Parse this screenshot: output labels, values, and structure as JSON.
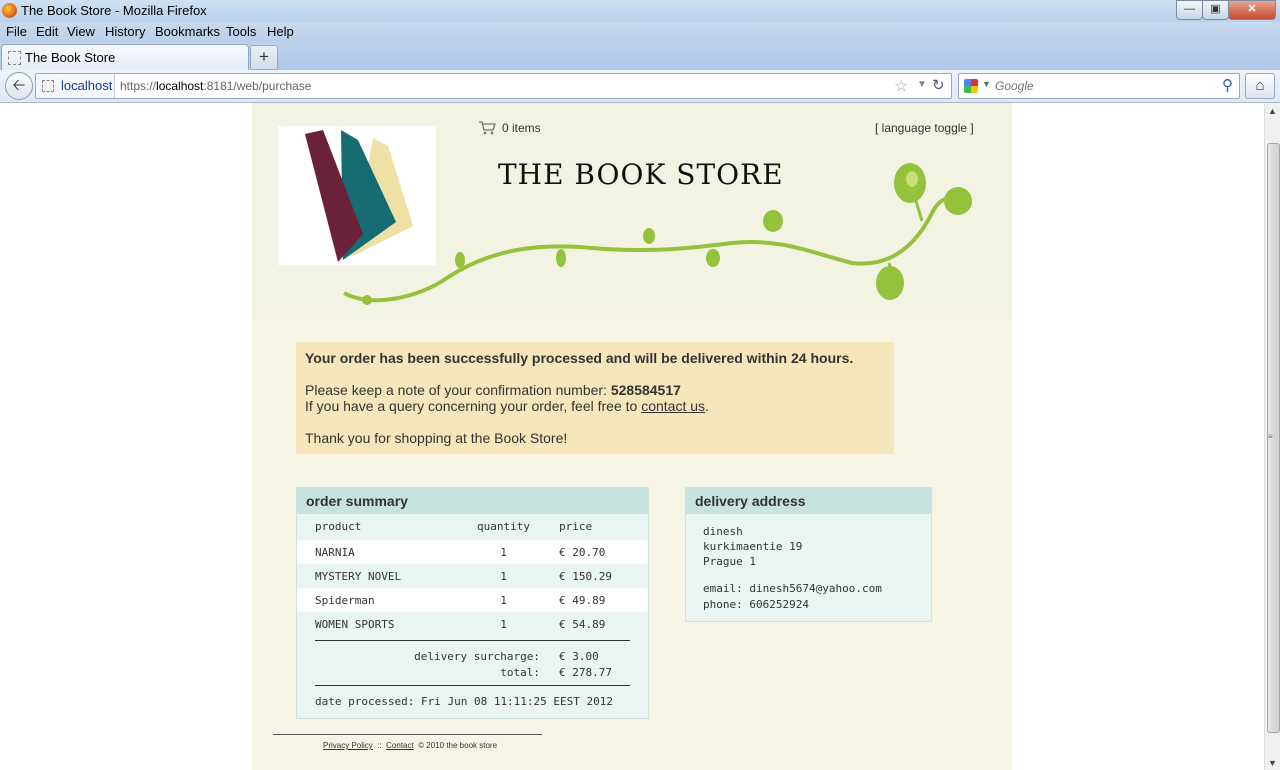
{
  "window": {
    "title": "The Book Store - Mozilla Firefox"
  },
  "menu": {
    "items": [
      "File",
      "Edit",
      "View",
      "History",
      "Bookmarks",
      "Tools",
      "Help"
    ]
  },
  "tabs": [
    {
      "label": "The Book Store"
    }
  ],
  "nav": {
    "identity_host": "localhost",
    "url_prefix": "https://",
    "url_host": "localhost",
    "url_rest": ":8181/web/purchase",
    "search_placeholder": "Google"
  },
  "store": {
    "cart_text": "0 items",
    "language_toggle": "[ language toggle ]",
    "title": "THE BOOK STORE"
  },
  "confirmation": {
    "headline": "Your order has been successfully processed and will be delivered within 24 hours.",
    "note_prefix": "Please keep a note of your confirmation number: ",
    "confirmation_number": "528584517",
    "query_prefix": "If you have a query concerning your order, feel free to ",
    "contact_link": "contact us",
    "query_suffix": ".",
    "thanks": "Thank you for shopping at the Book Store!"
  },
  "order_summary": {
    "heading": "order summary",
    "columns": [
      "product",
      "quantity",
      "price"
    ],
    "items": [
      {
        "product": "NARNIA",
        "quantity": "1",
        "price": "€ 20.70"
      },
      {
        "product": "MYSTERY NOVEL",
        "quantity": "1",
        "price": "€ 150.29"
      },
      {
        "product": "Spiderman",
        "quantity": "1",
        "price": "€ 49.89"
      },
      {
        "product": "WOMEN SPORTS",
        "quantity": "1",
        "price": "€ 54.89"
      }
    ],
    "surcharge_label": "delivery surcharge:",
    "surcharge_value": "€ 3.00",
    "total_label": "total:",
    "total_value": "€ 278.77",
    "date_label": "date processed:",
    "date_value": "Fri Jun 08 11:11:25 EEST 2012"
  },
  "delivery_address": {
    "heading": "delivery address",
    "lines": [
      "dinesh",
      "kurkimaentie 19",
      "Prague 1"
    ],
    "email_label": "email:",
    "email": "dinesh5674@yahoo.com",
    "phone_label": "phone:",
    "phone": "606252924"
  },
  "footer": {
    "privacy": "Privacy Policy",
    "sep": "::",
    "contact": "Contact",
    "copyright": "© 2010 the book store"
  },
  "colors": {
    "page_bg": "#f6f5e5",
    "message_bg": "#f5e6bc",
    "panel_header": "#c6e3df",
    "panel_bg": "#eaf4f1",
    "vine_green": "#95c23d",
    "book_maroon": "#6b2238",
    "book_teal": "#176b73",
    "book_cream": "#efe0a6"
  },
  "icons": [
    "firefox-icon",
    "back-arrow-icon",
    "star-icon",
    "reload-icon",
    "google-icon",
    "magnifier-icon",
    "home-icon",
    "cart-icon"
  ]
}
